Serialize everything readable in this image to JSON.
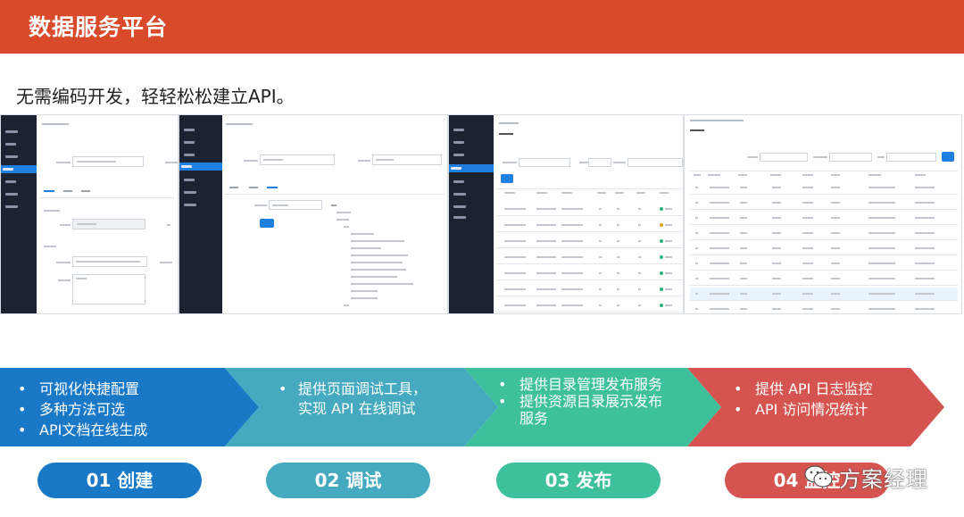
{
  "header": {
    "title": "数据服务平台"
  },
  "subtitle": "无需编码开发，轻轻松松建立API。",
  "colors": {
    "header_bg": "#d94a2b",
    "step1": "#1a79c6",
    "step2": "#45aabf",
    "step3": "#3fc09c",
    "step4": "#d65450"
  },
  "steps": [
    {
      "bullets": [
        "可视化快捷配置",
        "多种方法可选",
        "API文档在线生成"
      ],
      "label": "01 创建"
    },
    {
      "bullets": [
        "提供页面调试工具，实现 API 在线调试"
      ],
      "label": "02 调试"
    },
    {
      "bullets": [
        "提供目录管理发布服务",
        "提供资源目录展示发布服务"
      ],
      "label": "03 发布"
    },
    {
      "bullets": [
        "提供 API 日志监控",
        "API 访问情况统计"
      ],
      "label": "04 监控"
    }
  ],
  "watermark": {
    "icon": "wechat-icon",
    "text": "方案经理"
  }
}
